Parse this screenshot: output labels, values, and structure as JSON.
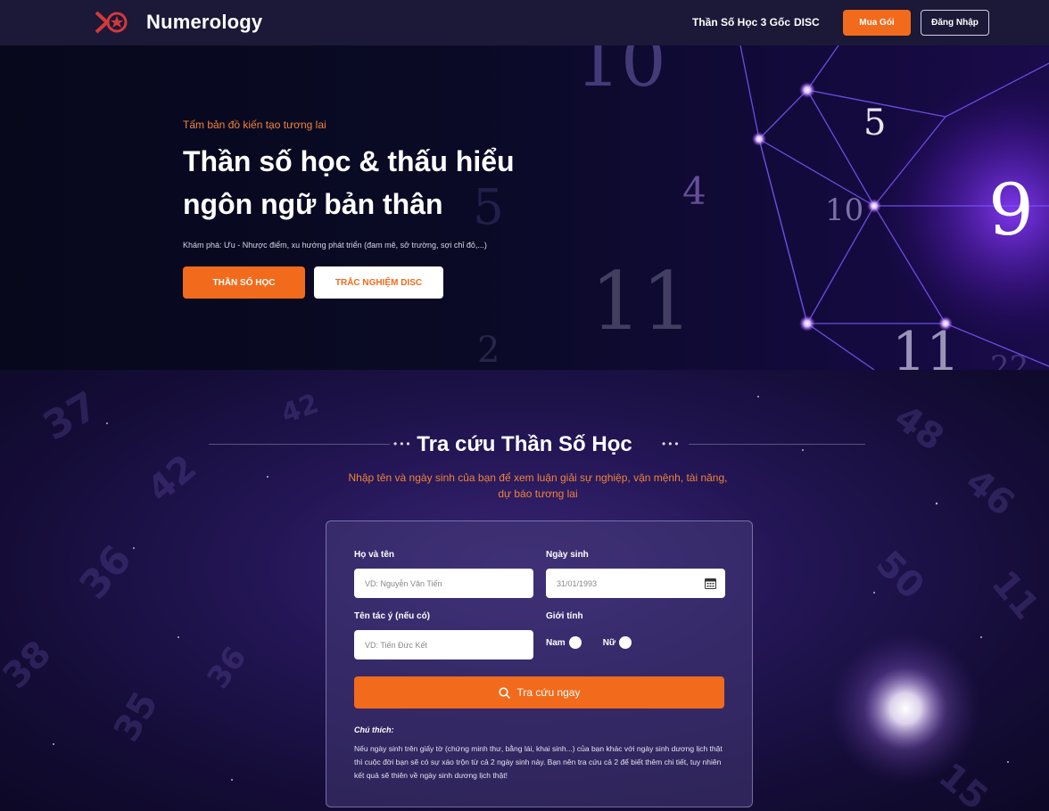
{
  "nav": {
    "brand": "Numerology",
    "links": [
      "Thần Số Học 3 Gốc",
      "DISC"
    ],
    "buy_label": "Mua Gói",
    "login_label": "Đăng Nhập"
  },
  "hero": {
    "eyebrow": "Tấm bản đồ kiến tạo tương lai",
    "title": "Thần số học & thấu hiểu ngôn ngữ bản thân",
    "description": "Khám phá: Ưu - Nhược điểm, xu hướng phát triển (đam mê, sở trường, sợi chỉ đỏ,...)",
    "primary_button": "THẦN SỐ HỌC",
    "secondary_button": "TRẮC NGHIỆM DISC",
    "decor_numbers": [
      "10",
      "5",
      "4",
      "10",
      "9",
      "5",
      "11",
      "2",
      "11",
      "22"
    ]
  },
  "lookup": {
    "heading": "Tra cứu Thần Số Học",
    "subtitle": "Nhập tên và ngày sinh của bạn để xem luận giải sự nghiệp, vận mệnh, tài năng, dự báo tương lai",
    "form": {
      "name_label": "Họ và tên",
      "name_placeholder": "VD: Nguyễn Văn Tiến",
      "dob_label": "Ngày sinh",
      "dob_value": "31/01/1993",
      "alias_label": "Tên tác ý (nếu có)",
      "alias_placeholder": "VD: Tiến Đức Kết",
      "gender_label": "Giới tính",
      "gender_options": [
        "Nam",
        "Nữ"
      ],
      "submit_label": "Tra cứu ngay",
      "note_title": "Chú thích:",
      "note_body": "Nếu ngày sinh trên giấy tờ (chứng minh thư, bằng lái, khai sinh...) của bạn khác với ngày sinh dương lịch thật thì cuộc đời bạn sẽ có sự xáo trộn từ cả 2 ngày sinh này. Bạn nên tra cứu cả 2 để biết thêm chi tiết, tuy nhiên kết quả sẽ thiên về ngày sinh dương lịch thật!"
    }
  },
  "colors": {
    "accent": "#f26a1b",
    "nav_bg": "#1b1838",
    "hero_bg": "#07081c",
    "section_bg": "#241656"
  }
}
